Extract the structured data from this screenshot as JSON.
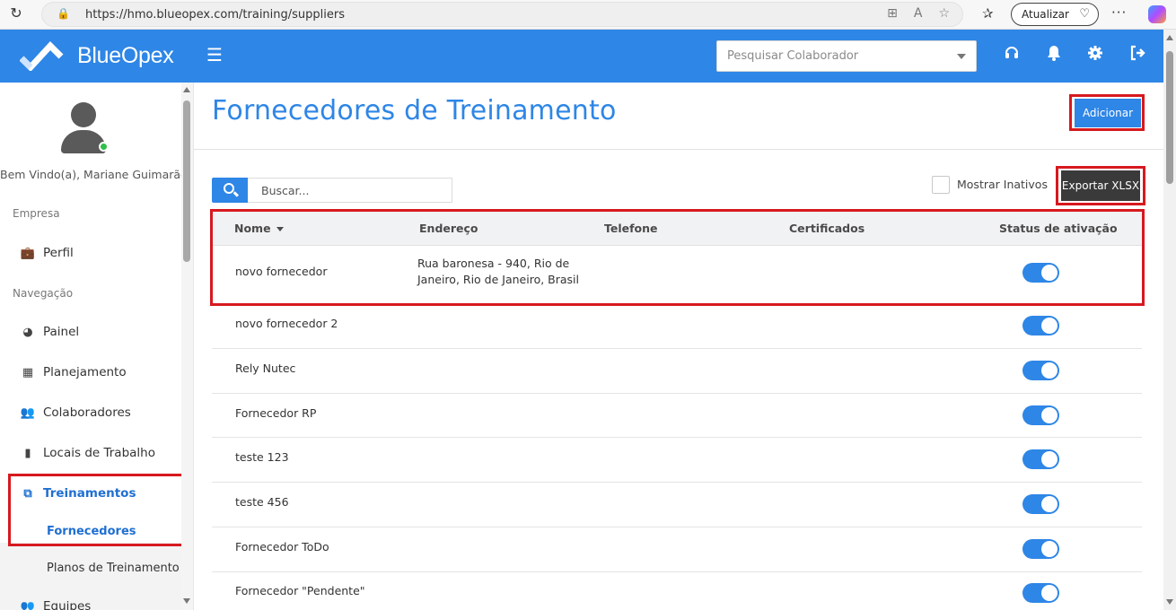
{
  "browser": {
    "url": "https://hmo.blueopex.com/training/suppliers",
    "update_label": "Atualizar"
  },
  "header": {
    "brand": "BlueOpex",
    "search_placeholder": "Pesquisar Colaborador",
    "accent_color": "#2e86e6"
  },
  "sidebar": {
    "welcome": "Bem Vindo(a), Mariane Guimarães",
    "sections": [
      "Empresa",
      "Navegação"
    ],
    "company_items": [
      {
        "label": "Perfil",
        "icon": "briefcase-icon"
      }
    ],
    "nav_items": [
      {
        "label": "Painel",
        "icon": "dashboard-icon"
      },
      {
        "label": "Planejamento",
        "icon": "calendar-icon"
      },
      {
        "label": "Colaboradores",
        "icon": "users-icon"
      },
      {
        "label": "Locais de Trabalho",
        "icon": "building-icon"
      },
      {
        "label": "Treinamentos",
        "icon": "training-icon"
      },
      {
        "label": "Equipes",
        "icon": "team-icon"
      }
    ],
    "sub_items": [
      {
        "label": "Fornecedores",
        "active": true
      },
      {
        "label": "Planos de Treinamento",
        "active": false
      }
    ]
  },
  "main": {
    "title": "Fornecedores de Treinamento",
    "add_label": "Adicionar",
    "export_label": "Exportar XLSX",
    "search_placeholder": "Buscar...",
    "show_inactive_label": "Mostrar Inativos",
    "show_inactive_checked": false,
    "columns": [
      "Nome",
      "Endereço",
      "Telefone",
      "Certificados",
      "Status de ativação"
    ],
    "rows": [
      {
        "name": "novo fornecedor",
        "address_line1": "Rua baronesa - 940, Rio de",
        "address_line2": "Janeiro, Rio de Janeiro, Brasil",
        "active": true
      },
      {
        "name": "novo fornecedor 2",
        "address_line1": "",
        "address_line2": "",
        "active": true
      },
      {
        "name": "Rely Nutec",
        "address_line1": "",
        "address_line2": "",
        "active": true
      },
      {
        "name": "Fornecedor RP",
        "address_line1": "",
        "address_line2": "",
        "active": true
      },
      {
        "name": "teste 123",
        "address_line1": "",
        "address_line2": "",
        "active": true
      },
      {
        "name": "teste 456",
        "address_line1": "",
        "address_line2": "",
        "active": true
      },
      {
        "name": "Fornecedor ToDo",
        "address_line1": "",
        "address_line2": "",
        "active": true
      },
      {
        "name": "Fornecedor \"Pendente\"",
        "address_line1": "",
        "address_line2": "",
        "active": true
      }
    ]
  }
}
